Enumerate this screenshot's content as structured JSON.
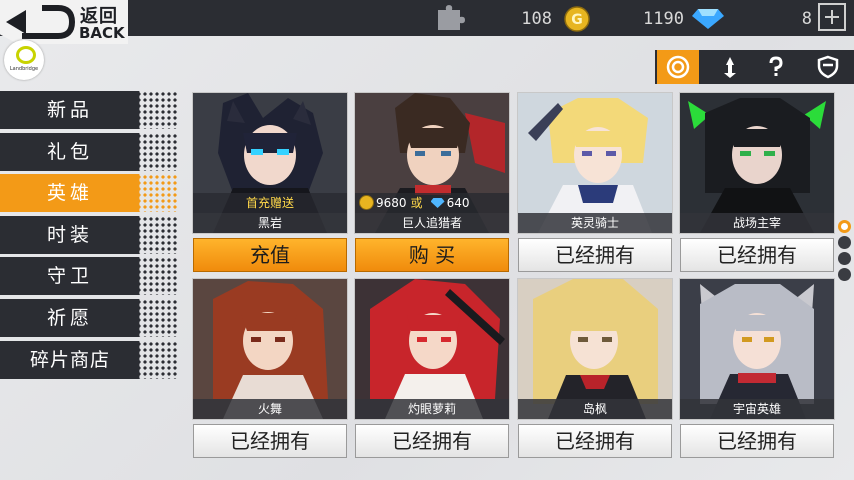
{
  "header": {
    "back_cn": "返回",
    "back_en": "BACK",
    "resources": [
      {
        "icon": "puzzle-piece-icon",
        "value": ""
      },
      {
        "icon": "gold-coin-icon",
        "value": "108"
      },
      {
        "icon": "diamond-gem-icon",
        "value": "1190"
      },
      {
        "icon": "stamina-icon",
        "value": "8"
      }
    ],
    "logo_text": "Landbridge",
    "accent_color": "#f39a17"
  },
  "filter_tabs": [
    {
      "icon": "coin-ring-icon",
      "active": true
    },
    {
      "icon": "sword-icon",
      "active": false
    },
    {
      "icon": "question-mark-icon",
      "active": false
    },
    {
      "icon": "shield-icon",
      "active": false
    }
  ],
  "sidebar": {
    "items": [
      {
        "label": "新品"
      },
      {
        "label": "礼包"
      },
      {
        "label": "英雄",
        "active": true
      },
      {
        "label": "时装"
      },
      {
        "label": "守卫"
      },
      {
        "label": "祈愿"
      },
      {
        "label": "碎片商店"
      }
    ]
  },
  "heroes": [
    {
      "name": "黑岩",
      "tag": "首充赠送",
      "button": "充值",
      "style": "orange"
    },
    {
      "name": "巨人追猎者",
      "price_gold": "9680",
      "price_or": "或",
      "price_gem": "640",
      "button": "购 买",
      "style": "orange"
    },
    {
      "name": "英灵骑士",
      "button": "已经拥有",
      "style": "owned"
    },
    {
      "name": "战场主宰",
      "button": "已经拥有",
      "style": "owned"
    },
    {
      "name": "火舞",
      "button": "已经拥有",
      "style": "owned"
    },
    {
      "name": "灼眼萝莉",
      "button": "已经拥有",
      "style": "owned"
    },
    {
      "name": "岛枫",
      "button": "已经拥有",
      "style": "owned"
    },
    {
      "name": "宇宙英雄",
      "button": "已经拥有",
      "style": "owned"
    }
  ],
  "pager": {
    "pages": 3,
    "current": 1
  }
}
